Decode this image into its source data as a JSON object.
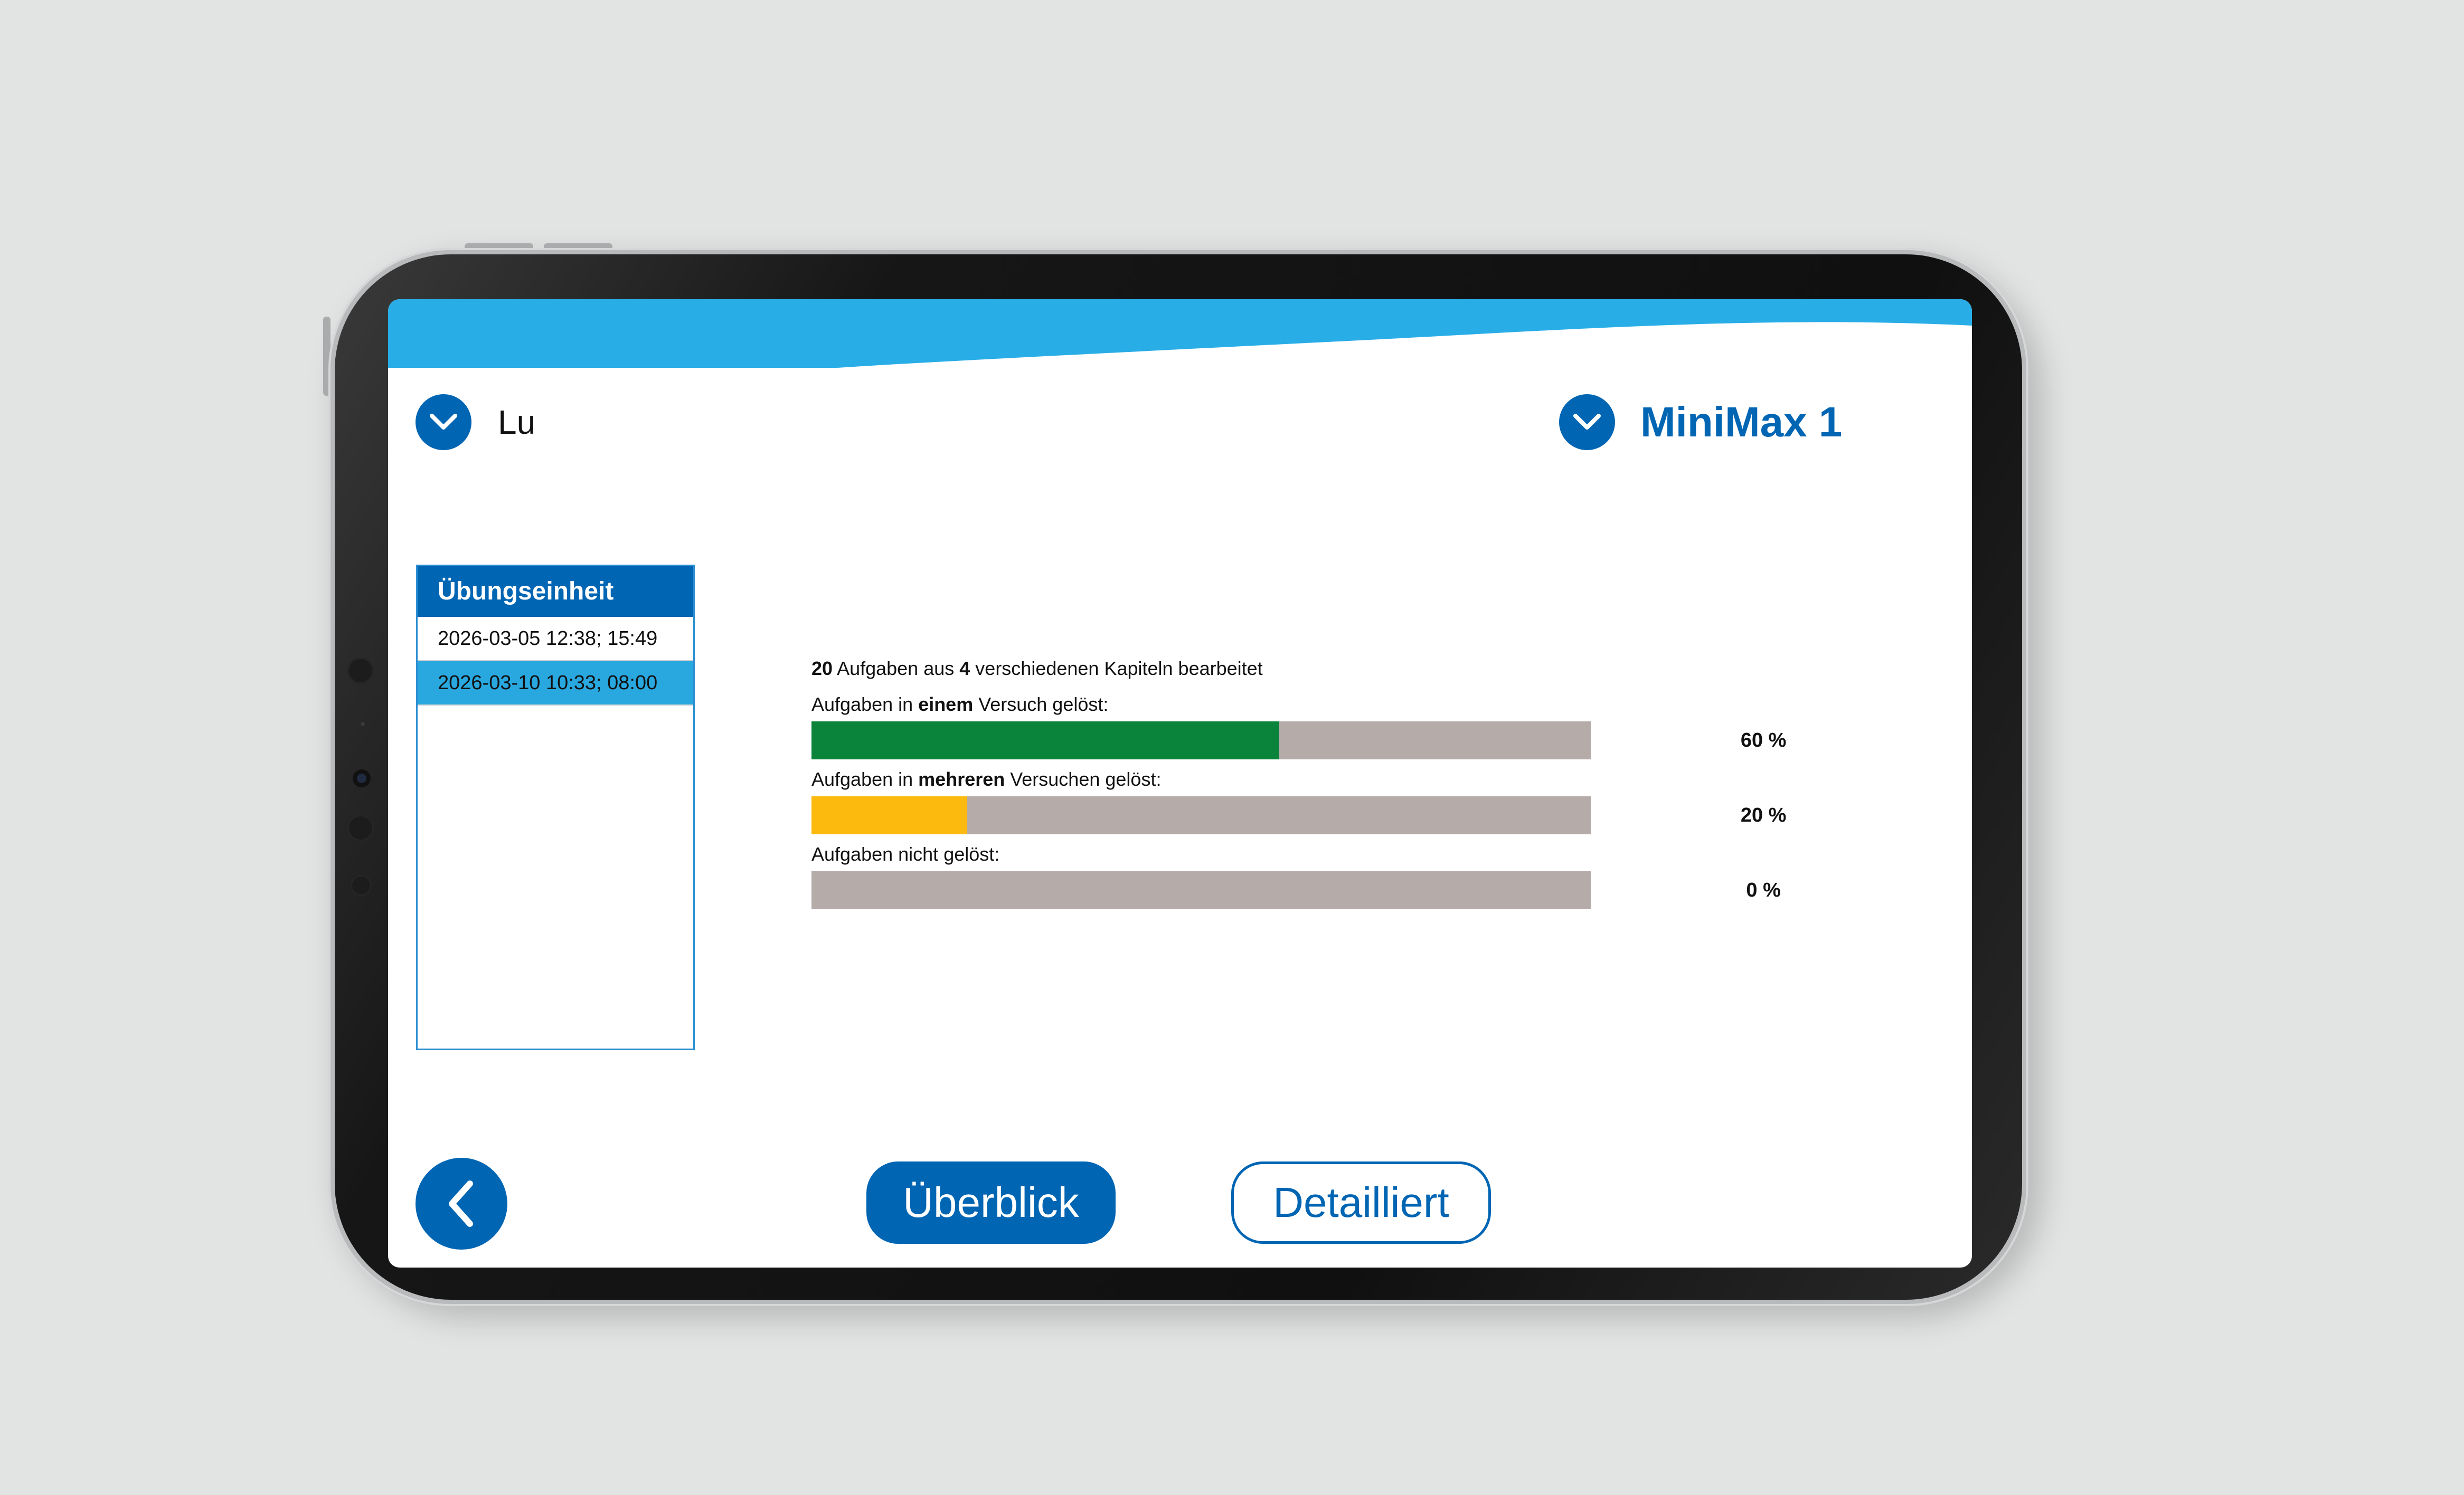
{
  "header": {
    "user_dropdown": {
      "value": "Lu",
      "icon": "chevron-down-icon"
    },
    "book_dropdown": {
      "value": "MiniMax 1",
      "icon": "chevron-down-icon"
    }
  },
  "sessions": {
    "header": "Übungseinheit",
    "items": [
      {
        "label": "2026-03-05 12:38; 15:49",
        "selected": false
      },
      {
        "label": "2026-03-10 10:33; 08:00",
        "selected": true
      }
    ]
  },
  "stats": {
    "summary": {
      "count": "20",
      "text1": " Aufgaben aus ",
      "chapters": "4",
      "text2": " verschiedenen Kapiteln bearbeitet"
    },
    "rows": [
      {
        "label_pre": "Aufgaben in ",
        "label_bold": "einem",
        "label_post": " Versuch gelöst:",
        "percent": 60,
        "value": "60 %",
        "color": "#0a843a"
      },
      {
        "label_pre": "Aufgaben in ",
        "label_bold": "mehreren",
        "label_post": " Versuchen gelöst:",
        "percent": 20,
        "value": "20 %",
        "color": "#fbba0d"
      },
      {
        "label_pre": "Aufgaben nicht gelöst:",
        "label_bold": "",
        "label_post": "",
        "percent": 0,
        "value": "0 %",
        "color": "#b5aba9"
      }
    ]
  },
  "footer": {
    "back_icon": "chevron-left-icon",
    "overview_label": "Überblick",
    "detail_label": "Detailliert"
  },
  "colors": {
    "brand_blue": "#0065b3",
    "header_wave": "#29ade6",
    "selected_row": "#29a8e0",
    "bar_track": "#b5aba9"
  }
}
